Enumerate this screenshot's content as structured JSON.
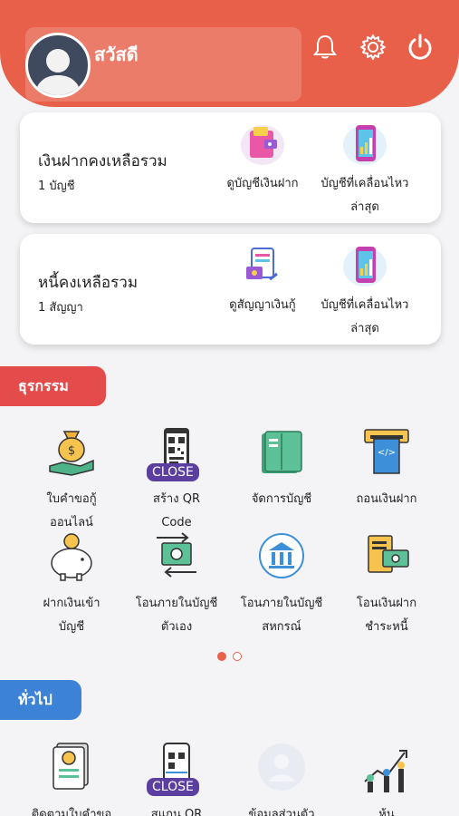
{
  "header": {
    "greeting": "สวัสดี",
    "icons": [
      "bell-icon",
      "gear-icon",
      "power-icon"
    ]
  },
  "cards": [
    {
      "title": "เงินฝากคงเหลือรวม",
      "subtitle": "1 บัญชี",
      "actions": [
        {
          "label": "ดูบัญชีเงินฝาก",
          "icon": "wallet-icon"
        },
        {
          "label": "บัญชีที่เคลื่อนไหว\nล่าสุด",
          "icon": "phone-chart-icon"
        }
      ]
    },
    {
      "title": "หนี้คงเหลือรวม",
      "subtitle": "1 สัญญา",
      "actions": [
        {
          "label": "ดูสัญญาเงินกู้",
          "icon": "loan-contract-icon"
        },
        {
          "label": "บัญชีที่เคลื่อนไหว\nล่าสุด",
          "icon": "phone-chart-icon"
        }
      ]
    }
  ],
  "transactions": {
    "title": "ธุรกรรม",
    "items": [
      {
        "label": "ใบคำขอกู้\nออนไลน์",
        "icon": "money-bag-hand-icon"
      },
      {
        "label": "สร้าง QR\nCode",
        "icon": "qr-code-icon"
      },
      {
        "label": "จัดการบัญชี",
        "icon": "account-book-icon"
      },
      {
        "label": "ถอนเงินฝาก",
        "icon": "atm-icon"
      },
      {
        "label": "ฝากเงินเข้า\nบัญชี",
        "icon": "piggy-bank-icon"
      },
      {
        "label": "โอนภายในบัญชี\nตัวเอง",
        "icon": "transfer-icon"
      },
      {
        "label": "โอนภายในบัญชี\nสหกรณ์",
        "icon": "bank-icon"
      },
      {
        "label": "โอนเงินฝาก\nชำระหนี้",
        "icon": "bill-money-icon"
      }
    ]
  },
  "general": {
    "title": "ทั่วไป",
    "items": [
      {
        "label": "ติดตามใบคำขอ",
        "icon": "document-money-icon"
      },
      {
        "label": "สแกน QR",
        "icon": "scan-qr-icon"
      },
      {
        "label": "ข้อมูลส่วนตัว",
        "icon": "profile-icon"
      },
      {
        "label": "หุ้น",
        "icon": "stock-people-icon"
      }
    ]
  },
  "overlay": {
    "close_label": "CLOSE"
  },
  "pager": {
    "pages": 2,
    "active": 1
  },
  "colors": {
    "primary": "#e8604a",
    "section_red": "#e44b4b",
    "section_blue": "#3c82d6"
  }
}
